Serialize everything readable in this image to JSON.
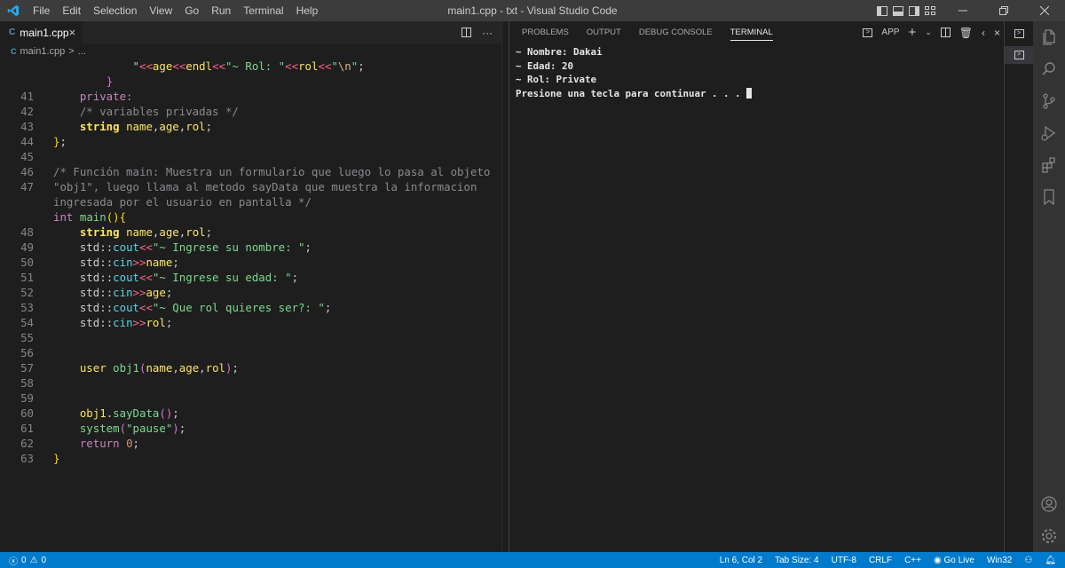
{
  "window": {
    "title": "main1.cpp - txt - Visual Studio Code",
    "menu": [
      "File",
      "Edit",
      "Selection",
      "View",
      "Go",
      "Run",
      "Terminal",
      "Help"
    ]
  },
  "editor": {
    "tab_label": "main1.cpp",
    "breadcrumb": "main1.cpp",
    "breadcrumb_sep": ">",
    "breadcrumb_more": "...",
    "lines": [
      {
        "n": "",
        "html": "            <span class=\"pl\">\"</span><span class=\"op\">&lt;&lt;</span><span class=\"id\">age</span><span class=\"op\">&lt;&lt;</span><span class=\"id\">endl</span><span class=\"op\">&lt;&lt;</span><span class=\"str\">\"~ Rol: \"</span><span class=\"op\">&lt;&lt;</span><span class=\"id\">rol</span><span class=\"op\">&lt;&lt;</span><span class=\"str\">\"</span><span class=\"esc\">\\n</span><span class=\"str\">\"</span><span class=\"pl\">;</span>"
      },
      {
        "n": "",
        "html": "        <span class=\"br2\">}</span>"
      },
      {
        "n": "41",
        "html": "    <span class=\"kw\">private:</span>"
      },
      {
        "n": "42",
        "html": "    <span class=\"cm\">/* variables privadas */</span>"
      },
      {
        "n": "43",
        "html": "    <span class=\"ty\">string</span> <span class=\"id\">name</span><span class=\"pl\">,</span><span class=\"id\">age</span><span class=\"pl\">,</span><span class=\"id\">rol</span><span class=\"pl\">;</span>"
      },
      {
        "n": "44",
        "html": "<span class=\"br\">}</span><span class=\"pl\">;</span>"
      },
      {
        "n": "45",
        "html": ""
      },
      {
        "n": "46",
        "html": "<span class=\"cm\">/* Función main: Muestra un formulario que luego lo pasa al objeto</span>"
      },
      {
        "n": "47",
        "html": "<span class=\"cm\">\"obj1\", luego llama al metodo sayData que muestra la informacion</span>"
      },
      {
        "n": "",
        "html": "<span class=\"cm\">ingresada por el usuario en pantalla */</span>"
      },
      {
        "n": "",
        "html": "<span class=\"kw\">int</span> <span class=\"fn\">main</span><span class=\"br\">(){</span>"
      },
      {
        "n": "48",
        "html": "    <span class=\"ty\">string</span> <span class=\"id\">name</span><span class=\"pl\">,</span><span class=\"id\">age</span><span class=\"pl\">,</span><span class=\"id\">rol</span><span class=\"pl\">;</span>"
      },
      {
        "n": "49",
        "html": "    <span class=\"ns\">std</span><span class=\"pl\">::</span><span class=\"var\">cout</span><span class=\"op\">&lt;&lt;</span><span class=\"str\">\"~ Ingrese su nombre: \"</span><span class=\"pl\">;</span>"
      },
      {
        "n": "50",
        "html": "    <span class=\"ns\">std</span><span class=\"pl\">::</span><span class=\"var\">cin</span><span class=\"op\">&gt;&gt;</span><span class=\"id\">name</span><span class=\"pl\">;</span>"
      },
      {
        "n": "51",
        "html": "    <span class=\"ns\">std</span><span class=\"pl\">::</span><span class=\"var\">cout</span><span class=\"op\">&lt;&lt;</span><span class=\"str\">\"~ Ingrese su edad: \"</span><span class=\"pl\">;</span>"
      },
      {
        "n": "52",
        "html": "    <span class=\"ns\">std</span><span class=\"pl\">::</span><span class=\"var\">cin</span><span class=\"op\">&gt;&gt;</span><span class=\"id\">age</span><span class=\"pl\">;</span>"
      },
      {
        "n": "53",
        "html": "    <span class=\"ns\">std</span><span class=\"pl\">::</span><span class=\"var\">cout</span><span class=\"op\">&lt;&lt;</span><span class=\"str\">\"~ Que rol quieres ser?: \"</span><span class=\"pl\">;</span>"
      },
      {
        "n": "54",
        "html": "    <span class=\"ns\">std</span><span class=\"pl\">::</span><span class=\"var\">cin</span><span class=\"op\">&gt;&gt;</span><span class=\"id\">rol</span><span class=\"pl\">;</span>"
      },
      {
        "n": "55",
        "html": ""
      },
      {
        "n": "56",
        "html": ""
      },
      {
        "n": "57",
        "html": "    <span class=\"id\">user</span> <span class=\"fn\">obj1</span><span class=\"br2\">(</span><span class=\"id\">name</span><span class=\"pl\">,</span><span class=\"id\">age</span><span class=\"pl\">,</span><span class=\"id\">rol</span><span class=\"br2\">)</span><span class=\"pl\">;</span>"
      },
      {
        "n": "58",
        "html": ""
      },
      {
        "n": "59",
        "html": ""
      },
      {
        "n": "60",
        "html": "    <span class=\"id\">obj1</span><span class=\"pl\">.</span><span class=\"fn\">sayData</span><span class=\"br2\">()</span><span class=\"pl\">;</span>"
      },
      {
        "n": "61",
        "html": "    <span class=\"fn\">system</span><span class=\"br2\">(</span><span class=\"str\">\"pause\"</span><span class=\"br2\">)</span><span class=\"pl\">;</span>"
      },
      {
        "n": "62",
        "html": "    <span class=\"kw\">return</span> <span class=\"num\">0</span><span class=\"pl\">;</span>"
      },
      {
        "n": "63",
        "html": "<span class=\"br\">}</span>"
      }
    ],
    "line_numbers": [
      "",
      "",
      "41",
      "42",
      "43",
      "44",
      "45",
      "46",
      "47",
      "",
      "",
      "48",
      "49",
      "50",
      "51",
      "52",
      "53",
      "54",
      "55",
      "56",
      "57",
      "58",
      "59",
      "60",
      "61",
      "62",
      "63"
    ]
  },
  "panel": {
    "tabs": [
      "PROBLEMS",
      "OUTPUT",
      "DEBUG CONSOLE",
      "TERMINAL"
    ],
    "active_tab": "TERMINAL",
    "terminal_name": "app",
    "terminal_lines": [
      "~ Nombre: Dakai",
      "~ Edad: 20",
      "~ Rol: Private",
      "Presione una tecla para continuar . . . "
    ]
  },
  "statusbar": {
    "errors": "0",
    "warnings": "0",
    "position": "Ln 6, Col 2",
    "tab_size": "Tab Size: 4",
    "encoding": "UTF-8",
    "eol": "CRLF",
    "language": "C++",
    "go_live": "Go Live",
    "platform": "Win32"
  },
  "colors": {
    "statusbar": "#007acc",
    "titlebar": "#3c3c3c",
    "editor_bg": "#1e1e1e",
    "activity_bar": "#333333"
  }
}
